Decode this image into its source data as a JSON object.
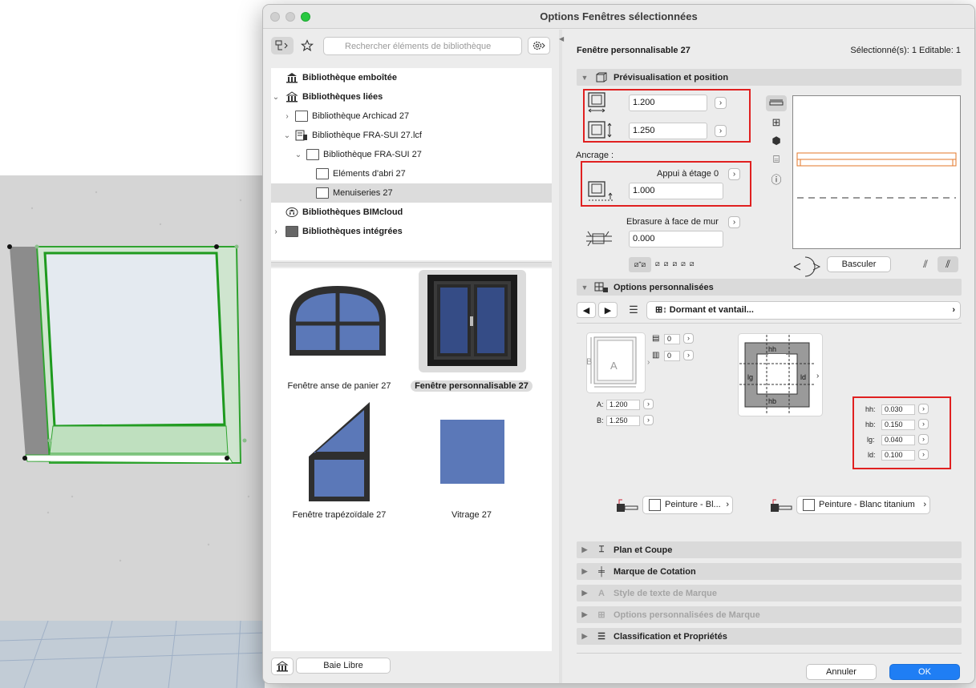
{
  "dialog": {
    "title": "Options Fenêtres sélectionnées"
  },
  "left": {
    "search_placeholder": "Rechercher éléments de bibliothèque",
    "tree": [
      {
        "label": "Bibliothèque emboîtée",
        "bold": true
      },
      {
        "label": "Bibliothèques liées",
        "bold": true
      },
      {
        "label": "Bibliothèque Archicad 27",
        "bold": false
      },
      {
        "label": "Bibliothèque FRA-SUI 27.lcf",
        "bold": false
      },
      {
        "label": "Bibliothèque FRA-SUI 27",
        "bold": false
      },
      {
        "label": "Eléments d'abri 27",
        "bold": false
      },
      {
        "label": "Menuiseries 27",
        "bold": false,
        "selected": true
      },
      {
        "label": "Bibliothèques BIMcloud",
        "bold": true
      },
      {
        "label": "Bibliothèques intégrées",
        "bold": true
      }
    ],
    "gallery": [
      {
        "label": "Fenêtre anse de panier 27",
        "selected": false
      },
      {
        "label": "Fenêtre personnalisable 27",
        "selected": true
      },
      {
        "label": "Fenêtre trapézoïdale 27",
        "selected": false
      },
      {
        "label": "Vitrage 27",
        "selected": false
      }
    ],
    "baie_libre": "Baie Libre"
  },
  "right": {
    "object_name": "Fenêtre personnalisable 27",
    "selection_info": "Sélectionné(s): 1 Editable: 1",
    "preview_section": "Prévisualisation et position",
    "width": "1.200",
    "height": "1.250",
    "anchor_label": "Ancrage :",
    "sill_label": "Appui à étage 0",
    "sill_value": "1.000",
    "reveal_label": "Ebrasure à face de mur",
    "reveal_value": "0.000",
    "flip_button": "Basculer",
    "custom_section": "Options personnalisées",
    "custom_dropdown": "Dormant et vantail...",
    "mini_a_label": "A:",
    "mini_a_value": "1.200",
    "mini_b_label": "B:",
    "mini_b_value": "1.250",
    "stepper_top": "0",
    "stepper_bottom": "0",
    "diagram_letter_a": "A",
    "diagram_letter_b": "B",
    "frame_labels": {
      "hh": "hh",
      "hb": "hb",
      "lg": "lg",
      "ld": "ld"
    },
    "frame_values": [
      {
        "label": "hh:",
        "value": "0.030"
      },
      {
        "label": "hb:",
        "value": "0.150"
      },
      {
        "label": "lg:",
        "value": "0.040"
      },
      {
        "label": "ld:",
        "value": "0.100"
      }
    ],
    "paint_left": "Peinture - Bl...",
    "paint_right": "Peinture - Blanc titanium",
    "sections": [
      {
        "label": "Plan et Coupe",
        "dim": false
      },
      {
        "label": "Marque de Cotation",
        "dim": false
      },
      {
        "label": "Style de texte de Marque",
        "dim": true
      },
      {
        "label": "Options personnalisées de Marque",
        "dim": true
      },
      {
        "label": "Classification et Propriétés",
        "dim": false
      }
    ],
    "cancel_button": "Annuler",
    "ok_button": "OK"
  },
  "colors": {
    "accent": "#1f7ef4",
    "glass": "#5b78b8",
    "frame_dark": "#2f2f2f",
    "highlight_red": "#e02020",
    "selection_green": "#2fa32f"
  }
}
